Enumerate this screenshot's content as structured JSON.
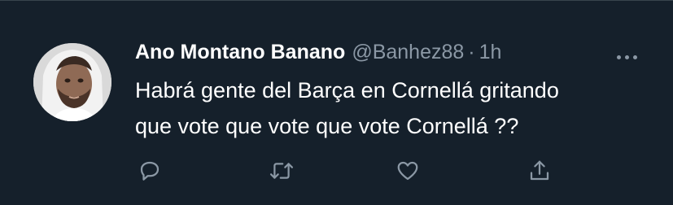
{
  "tweet": {
    "display_name": "Ano Montano Banano",
    "handle": "@Banhez88",
    "separator": "·",
    "time": "1h",
    "text_line_1": "Habrá gente del Barça en Cornellá gritando",
    "text_line_2": "que vote que vote que vote Cornellá ??"
  },
  "actions": {
    "reply_icon": "reply-icon",
    "retweet_icon": "retweet-icon",
    "like_icon": "heart-icon",
    "share_icon": "share-icon",
    "more_icon": "more-icon"
  },
  "colors": {
    "background": "#15202b",
    "secondary_text": "#8b98a5",
    "primary_text": "#ffffff"
  }
}
